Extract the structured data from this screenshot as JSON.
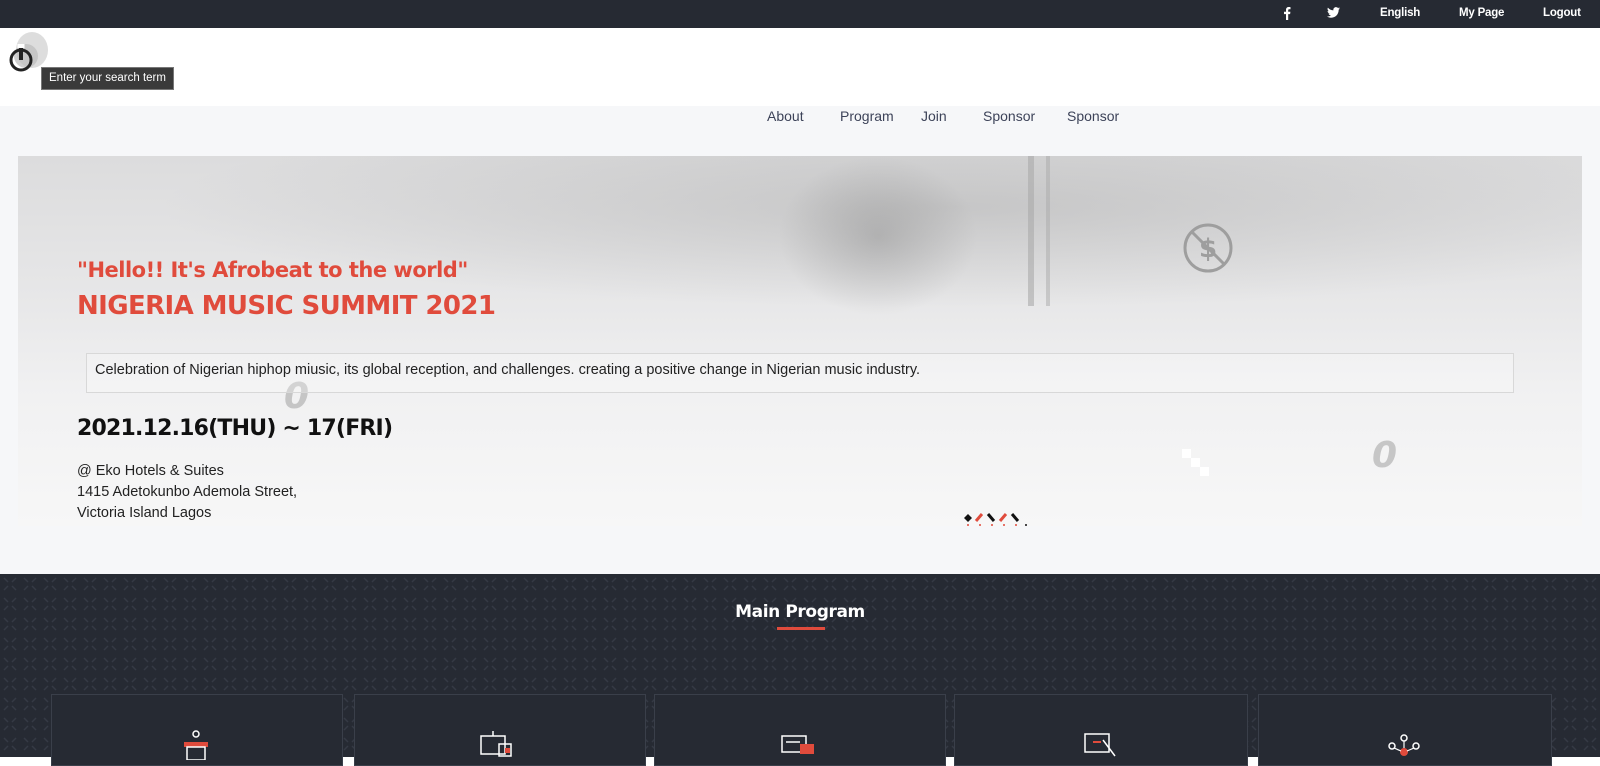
{
  "topbar": {
    "facebook_icon": "facebook-icon",
    "twitter_icon": "twitter-icon",
    "language": "English",
    "mypage": "My Page",
    "logout": "Logout"
  },
  "header": {
    "logo_icon": "power-logo-icon",
    "search_tooltip": "Enter your search term"
  },
  "nav": {
    "items": [
      "About",
      "Program",
      "Join",
      "Sponsor",
      "Sponsor"
    ]
  },
  "hero": {
    "subtitle": "\"Hello!! It's Afrobeat to the world\"",
    "title": "NIGERIA MUSIC SUMMIT 2021",
    "description": "Celebration of Nigerian hiphop miusic, its global reception, and challenges. creating a positive change in Nigerian music industry.",
    "date": "2021.12.16(THU) ~ 17(FRI)",
    "venue": [
      "@ Eko Hotels & Suites",
      "1415 Adetokunbo Ademola Street,",
      "Victoria Island Lagos"
    ]
  },
  "program": {
    "title": "Main Program",
    "card_icons": [
      "podium-icon",
      "presentation-icon",
      "laptop-icon",
      "whiteboard-icon",
      "network-icon"
    ]
  },
  "colors": {
    "accent": "#e04b3c",
    "dark": "#262a33"
  }
}
